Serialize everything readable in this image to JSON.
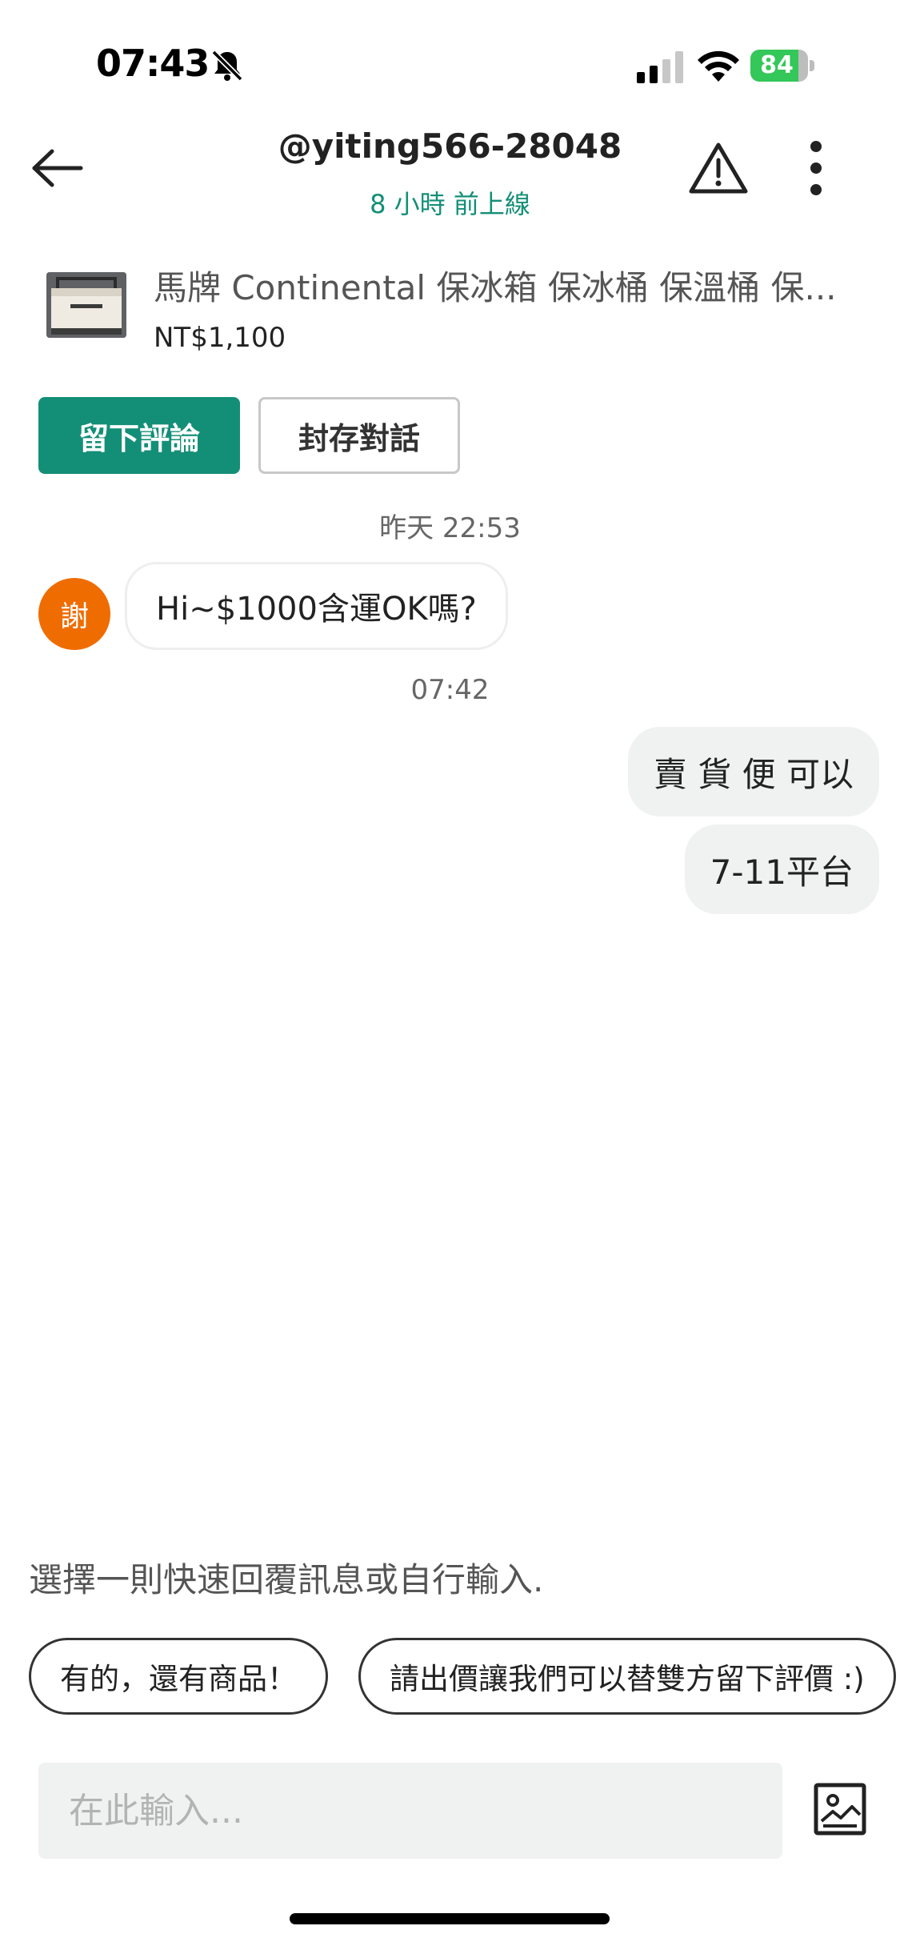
{
  "status_bar": {
    "time": "07:43",
    "battery": "84",
    "battery_level": 0.84
  },
  "header": {
    "title": "@yiting566-28048",
    "subtitle": "8 小時 前上線"
  },
  "product": {
    "title": "馬牌 Continental 保冰箱 保冰桶 保溫桶 保...",
    "price": "NT$1,100"
  },
  "actions": {
    "review_label": "留下評論",
    "archive_label": "封存對話"
  },
  "chat": {
    "messages": [
      {
        "timestamp": "昨天 22:53"
      },
      {
        "avatar": "謝",
        "text": "Hi~$1000含運OK嗎?"
      },
      {
        "timestamp": "07:42"
      },
      {
        "text": "賣 貨 便 可以"
      },
      {
        "text": "7-11平台"
      }
    ]
  },
  "quick_replies": {
    "hint": "選擇一則快速回覆訊息或自行輸入.",
    "options": [
      "有的，還有商品！",
      "請出價讓我們可以替雙方留下評價 :)"
    ]
  },
  "composer": {
    "placeholder": "在此輸入..."
  },
  "icons": {
    "back": "arrow-left-icon",
    "report": "warning-triangle-icon",
    "more": "vertical-dots-icon",
    "image": "image-upload-icon",
    "silent": "bell-off-icon",
    "signal": "signal-icon",
    "wifi": "wifi-icon"
  },
  "colors": {
    "accent": "#148f77",
    "avatar": "#ef6c00",
    "battery": "#34c759"
  }
}
